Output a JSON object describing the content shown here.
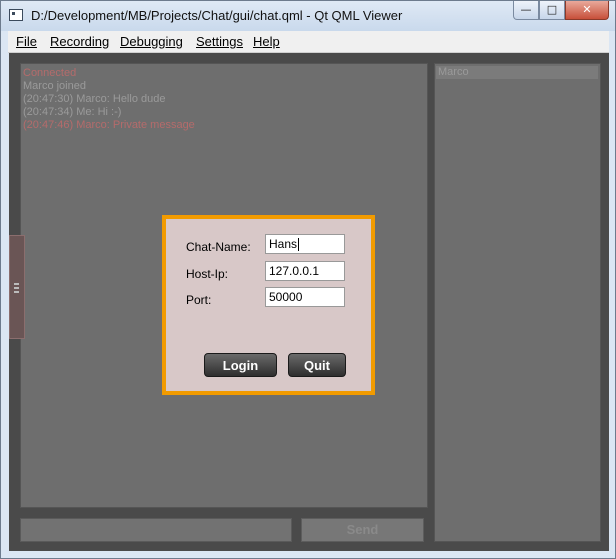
{
  "window": {
    "title": "D:/Development/MB/Projects/Chat/gui/chat.qml - Qt QML Viewer"
  },
  "menu": [
    {
      "label": "File"
    },
    {
      "label": "Recording"
    },
    {
      "label": "Debugging"
    },
    {
      "label": "Settings"
    },
    {
      "label": "Help"
    }
  ],
  "chat": {
    "messages": [
      {
        "text": "Connected",
        "color": "#b56b6b"
      },
      {
        "text": "Marco joined",
        "color": "#9a9a9a"
      },
      {
        "text": "(20:47:30) Marco: Hello dude",
        "color": "#9a9a9a"
      },
      {
        "text": "(20:47:34) Me: Hi :-)",
        "color": "#9a9a9a"
      },
      {
        "text": "(20:47:46) Marco:  Private message",
        "color": "#b56b6b"
      }
    ],
    "send_label": "Send",
    "message_input_value": ""
  },
  "users": [
    "Marco"
  ],
  "login_dialog": {
    "chat_name_label": "Chat-Name:",
    "chat_name_value": "Hans",
    "host_ip_label": "Host-Ip:",
    "host_ip_value": "127.0.0.1",
    "port_label": "Port:",
    "port_value": "50000",
    "login_label": "Login",
    "quit_label": "Quit"
  },
  "colors": {
    "dialog_border": "#f29b00",
    "dialog_bg": "#d8c8c8",
    "client_bg": "#4a4a4a",
    "panel_bg": "#6e6e6e"
  }
}
